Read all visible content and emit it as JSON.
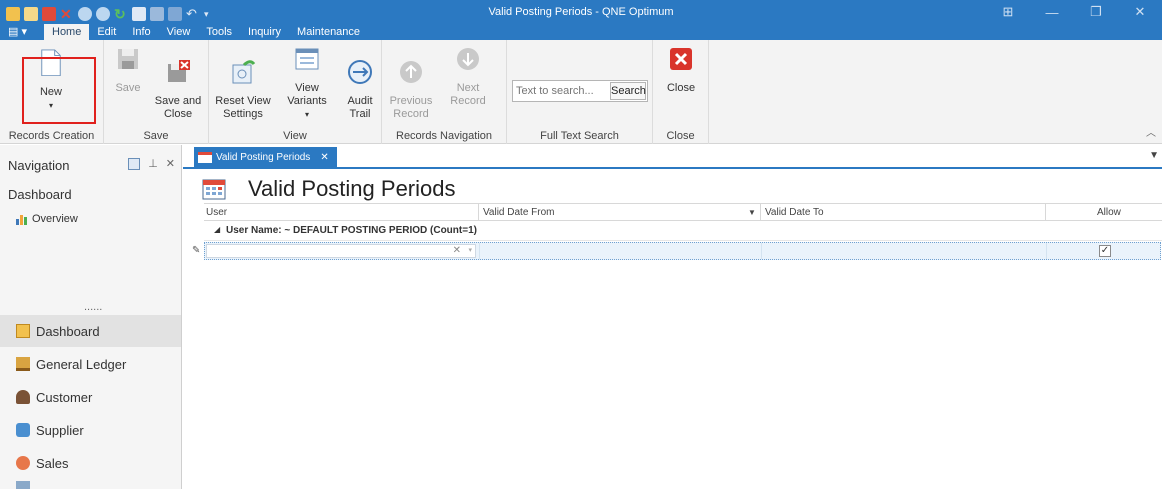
{
  "window": {
    "title": "Valid Posting Periods - QNE Optimum"
  },
  "menu_tabs": [
    "Home",
    "Edit",
    "Info",
    "View",
    "Tools",
    "Inquiry",
    "Maintenance"
  ],
  "ribbon": {
    "records_creation": {
      "new_label": "New",
      "group_label": "Records Creation"
    },
    "save": {
      "save_label": "Save",
      "save_close_label": "Save and\nClose",
      "group_label": "Save"
    },
    "view": {
      "reset_label": "Reset View\nSettings",
      "variants_label": "View Variants",
      "audit_label": "Audit\nTrail",
      "group_label": "View"
    },
    "records_navigation": {
      "previous_label": "Previous\nRecord",
      "next_label": "Next Record",
      "group_label": "Records Navigation"
    },
    "full_text_search": {
      "placeholder": "Text to search...",
      "button_label": "Search",
      "group_label": "Full Text Search"
    },
    "close": {
      "close_label": "Close",
      "group_label": "Close"
    }
  },
  "navigation": {
    "title": "Navigation",
    "section": "Dashboard",
    "overview": "Overview",
    "dots": "......",
    "items": [
      "Dashboard",
      "General Ledger",
      "Customer",
      "Supplier",
      "Sales"
    ]
  },
  "document": {
    "tab_label": "Valid Posting Periods",
    "heading": "Valid Posting Periods",
    "columns": [
      "User",
      "Valid Date From",
      "Valid Date To",
      "Allow"
    ],
    "group_row": "User Name: ~ DEFAULT POSTING PERIOD (Count=1)",
    "allow_checked": true
  },
  "colors": {
    "accent": "#2b79c2",
    "highlight": "#e0201c"
  }
}
